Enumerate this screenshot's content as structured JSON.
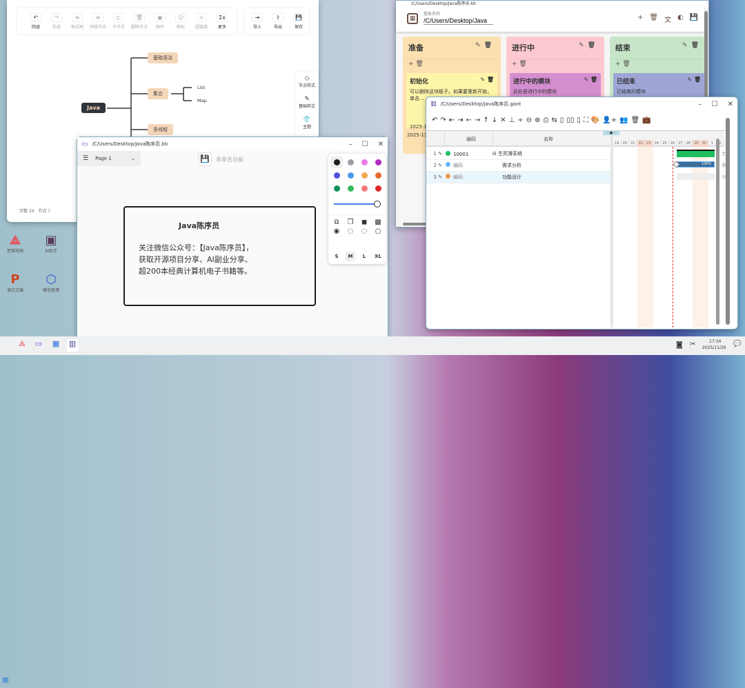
{
  "mindmap": {
    "toolbar": [
      {
        "label": "回退",
        "icon": "undo-icon",
        "g": "↶",
        "on": true
      },
      {
        "label": "前进",
        "icon": "redo-icon",
        "g": "↷"
      },
      {
        "label": "格式刷",
        "icon": "format-brush-icon",
        "g": "≡"
      },
      {
        "label": "同级节点",
        "icon": "sibling-node-icon",
        "g": "≡"
      },
      {
        "label": "子节点",
        "icon": "child-node-icon",
        "g": "⊏"
      },
      {
        "label": "删除节点",
        "icon": "trash-icon",
        "g": "🗑"
      },
      {
        "label": "图片",
        "icon": "image-icon",
        "g": "▣"
      },
      {
        "label": "图标",
        "icon": "emoji-icon",
        "g": "☺"
      },
      {
        "label": "超链接",
        "icon": "link-icon",
        "g": "∞"
      },
      {
        "label": "更多",
        "icon": "formula-icon",
        "g": "Σx",
        "on": true
      }
    ],
    "toolbar_right": [
      {
        "label": "导入",
        "icon": "import-icon",
        "g": "⇥"
      },
      {
        "label": "导出",
        "icon": "export-icon",
        "g": "⇪"
      },
      {
        "label": "保存",
        "icon": "save-icon",
        "g": "💾"
      }
    ],
    "side": [
      {
        "label": "节点样式",
        "g": "◇"
      },
      {
        "label": "基础样式",
        "g": "✎"
      },
      {
        "label": "主题",
        "g": "👕"
      }
    ],
    "root": "Java",
    "nodes": [
      "基础语法",
      "集合",
      "多线程"
    ],
    "leaves": [
      "List",
      "Map"
    ],
    "footer": {
      "words_label": "字数",
      "words": "24",
      "nodes_label": "节点",
      "nodes": "7"
    }
  },
  "desktop": [
    {
      "label": "思维导图",
      "color": "#e8474f",
      "g": "⟁"
    },
    {
      "label": "AI助手",
      "color": "#5a3a5a",
      "g": "▣"
    },
    {
      "label": "演示文稿",
      "color": "#d04423",
      "g": "P"
    },
    {
      "label": "模型管理",
      "color": "#3a56c8",
      "g": "⬡"
    }
  ],
  "kanban": {
    "title": "/C/Users/Desktop/Java陈序员.kb",
    "board_label": "看板名称",
    "board_name": "/C/Users/Desktop/Java",
    "columns": [
      {
        "title": "准备",
        "color": "#fde0b0",
        "card": {
          "title": "初始化",
          "text": "可以删除这块板子。如果要重新开始，单击...",
          "date": "2025-11-26",
          "color": "#fdf5a8"
        },
        "date": "2025-11-26"
      },
      {
        "title": "进行中",
        "color": "#fdc9d0",
        "card": {
          "title": "进行中的模块",
          "text": "此处是进行中的模块",
          "color": "#d48ed0"
        }
      },
      {
        "title": "结束",
        "color": "#c7e6c8",
        "card": {
          "title": "已结束",
          "text": "已结束的模块",
          "color": "#9fa6d6"
        }
      }
    ]
  },
  "gantt": {
    "title": "/C/Users/Desktop/Java陈序员.gant",
    "toolbar": [
      "↶",
      "↷",
      "⇤",
      "⇥",
      "←",
      "→",
      "↑",
      "↓",
      "✕",
      "⊥",
      "÷",
      "⊖",
      "⊕",
      "⎙",
      "⇆",
      "▯",
      "▯▯",
      "▯",
      "⛶",
      "🎨",
      "👤+",
      "👥",
      "🗑",
      "💼"
    ],
    "headers": {
      "code": "编码",
      "name": "名称"
    },
    "days": [
      "19",
      "20",
      "21",
      "22",
      "23",
      "24",
      "25",
      "26",
      "27",
      "28",
      "29",
      "30",
      "1",
      "2"
    ],
    "weekend": [
      "22",
      "23",
      "29",
      "30"
    ],
    "rows": [
      {
        "num": "1",
        "dot": "#1fbf60",
        "code": "10001",
        "name": "生死簿系统",
        "group": true,
        "side": "生"
      },
      {
        "num": "2",
        "dot": "#6ab4f0",
        "code": "编码",
        "name": "需求分析",
        "progress": 100,
        "progress_label": "100%",
        "side": "需"
      },
      {
        "num": "3",
        "dot": "#f59540",
        "code": "编码",
        "name": "功能设计",
        "side": "功"
      }
    ]
  },
  "whiteboard": {
    "title": "/C/Users/Desktop/Java陈序员.bb",
    "page": "Page 1",
    "name_placeholder": "未命名白板",
    "colors": [
      "#1e1e1e",
      "#9aa0a6",
      "#e879e8",
      "#b52cc0",
      "#5050e0",
      "#4a9af0",
      "#f0a850",
      "#e86a28",
      "#10905a",
      "#3cb860",
      "#f77878",
      "#e02828"
    ],
    "stroke_level": 100,
    "sizes": [
      "S",
      "M",
      "L",
      "XL"
    ],
    "size_selected": "M",
    "card_title": "Java陈序员",
    "card_lines": [
      "关注微信公众号：【Java陈序员】，",
      "获取开源项目分享、AI副业分享、",
      "超200本经典计算机电子书籍等。"
    ]
  },
  "taskbar": {
    "time": "17:34",
    "date": "2025/11/26"
  }
}
